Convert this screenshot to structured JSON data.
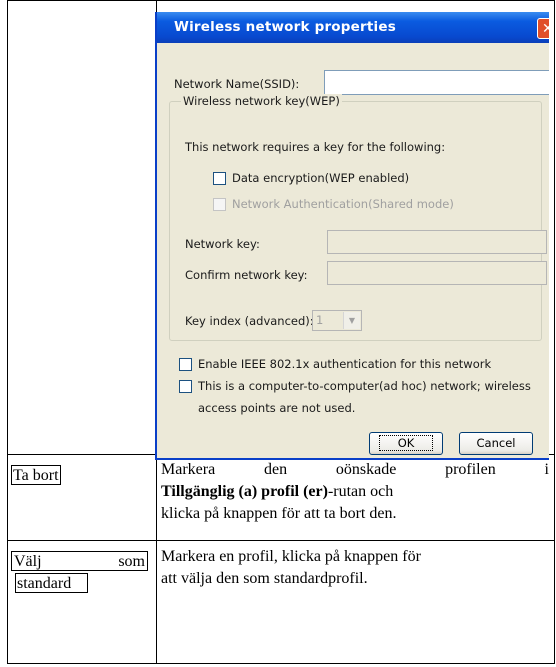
{
  "dialog": {
    "title": "Wireless network properties",
    "close_glyph": "✕",
    "network_name_label": "Network Name(SSID):",
    "network_name_value": "",
    "group_label": "Wireless network key(WEP)",
    "requires_key_text": "This network requires a key for the following:",
    "data_encryption_label": "Data encryption(WEP enabled)",
    "network_auth_label": "Network Authentication(Shared mode)",
    "network_key_label": "Network key:",
    "confirm_key_label": "Confirm network key:",
    "key_index_label": "Key index (advanced):",
    "key_index_value": "1",
    "ieee_label": "Enable IEEE 802.1x authentication for this network",
    "adhoc_line1": "This is a computer-to-computer(ad hoc) network; wireless",
    "adhoc_line2": "access points are not used.",
    "ok_label": "OK",
    "cancel_label": "Cancel"
  },
  "rows": [
    {
      "name": "Ta bort",
      "desc_line1_words": [
        "Markera",
        "den",
        "oönskade",
        "profilen",
        "i"
      ],
      "desc_line2_bold": "Tillgänglig (a) profil (er)",
      "desc_line2_rest": "-rutan och",
      "desc_line3": "klicka på knappen för att ta bort den."
    },
    {
      "name_part1": "Välj",
      "name_part2": "som",
      "name_part3": "standard",
      "desc_line1": "Markera en profil, klicka på knappen för",
      "desc_line2": "att välja den som standardprofil."
    }
  ],
  "colors": {
    "titlebar": "#0a5be0",
    "dialog_bg": "#ece9d8",
    "close_button": "#e04e2a"
  }
}
